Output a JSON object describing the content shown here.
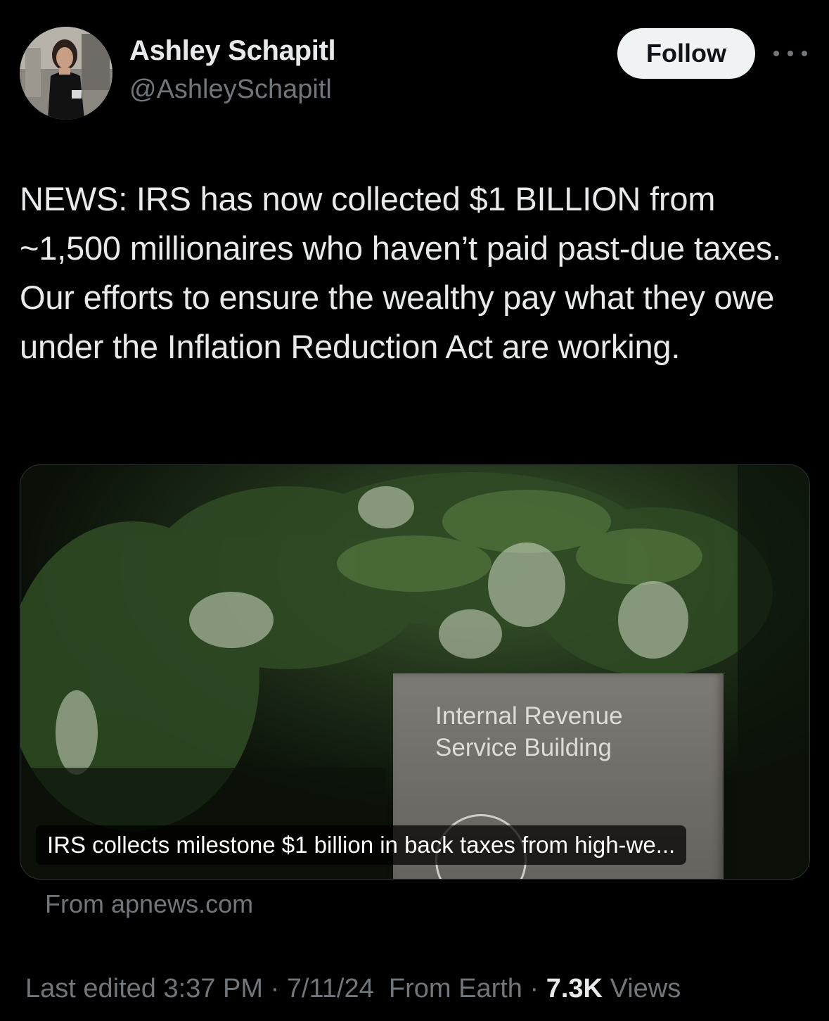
{
  "author": {
    "display_name": "Ashley Schapitl",
    "handle": "@AshleySchapitl"
  },
  "header": {
    "follow_label": "Follow",
    "more_icon": "more-horizontal-icon"
  },
  "tweet": {
    "text": "NEWS: IRS has now collected $1 BILLION from ~1,500 millionaires who haven’t paid past-due taxes. Our efforts to ensure the wealthy pay what they owe under the Inflation Reduction Act are working."
  },
  "link_card": {
    "sign_line_1": "Internal Revenue",
    "sign_line_2": "Service Building",
    "headline": "IRS collects milestone $1 billion in back taxes from high-we...",
    "source": "From apnews.com"
  },
  "meta": {
    "edited_label": "Last edited",
    "time": "3:37 PM",
    "separator_1": "·",
    "date": "7/11/24",
    "location": "From Earth",
    "separator_2": "·",
    "views_count": "7.3K",
    "views_label": "Views"
  },
  "colors": {
    "background": "#000000",
    "primary_text": "#e7e9ea",
    "secondary_text": "#71767b",
    "follow_bg": "#eff3f4"
  }
}
